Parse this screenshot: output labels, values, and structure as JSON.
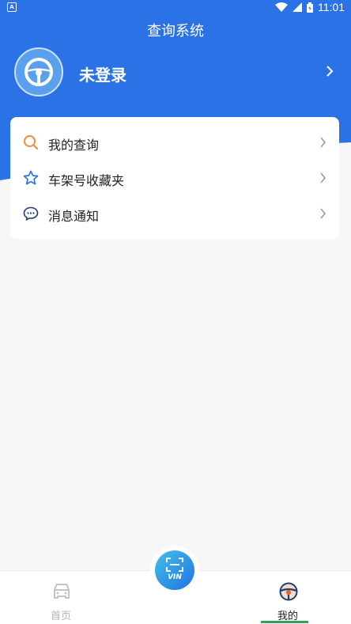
{
  "status_bar": {
    "time": "11:01",
    "badge": "A"
  },
  "app": {
    "title": "查询系统"
  },
  "profile": {
    "name": "未登录"
  },
  "menu": {
    "items": [
      {
        "label": "我的查询",
        "icon": "search-icon"
      },
      {
        "label": "车架号收藏夹",
        "icon": "star-icon"
      },
      {
        "label": "消息通知",
        "icon": "message-icon"
      }
    ]
  },
  "bottom_nav": {
    "home_label": "首页",
    "mine_label": "我的",
    "vin_label": "VIN"
  },
  "colors": {
    "primary": "#2a72e6",
    "search_icon": "#f08a3c",
    "star_icon": "#2a72e6",
    "active_underline": "#2da44e"
  }
}
